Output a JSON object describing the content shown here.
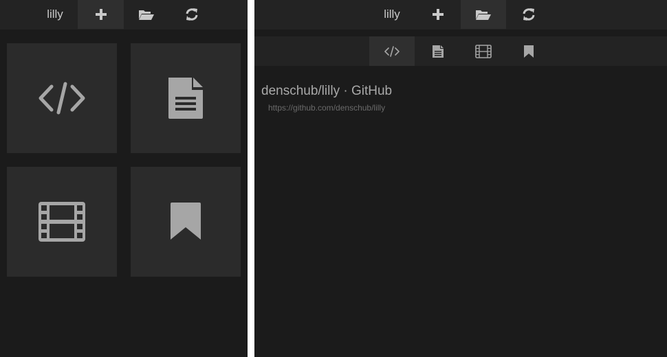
{
  "app": {
    "title": "lilly"
  },
  "left_panel": {
    "toolbar": {
      "title": "lilly",
      "add_icon": "plus-icon",
      "open_icon": "folder-open-icon",
      "refresh_icon": "refresh-icon",
      "active": "add"
    },
    "tiles": [
      {
        "icon": "code-icon"
      },
      {
        "icon": "document-icon"
      },
      {
        "icon": "film-icon"
      },
      {
        "icon": "bookmark-icon"
      }
    ]
  },
  "right_panel": {
    "toolbar": {
      "title": "lilly",
      "add_icon": "plus-icon",
      "open_icon": "folder-open-icon",
      "refresh_icon": "refresh-icon",
      "active": "open"
    },
    "filters": [
      {
        "icon": "code-icon",
        "active": true
      },
      {
        "icon": "document-icon",
        "active": false
      },
      {
        "icon": "film-icon",
        "active": false
      },
      {
        "icon": "bookmark-icon",
        "active": false
      }
    ],
    "result": {
      "title": "denschub/lilly · GitHub",
      "url": "https://github.com/denschub/lilly"
    }
  },
  "colors": {
    "background": "#1b1b1b",
    "bar": "#232323",
    "active": "#2f2f2f",
    "tile": "#2b2b2b",
    "icon": "#a6a6a6",
    "text": "#c9c9c9"
  }
}
